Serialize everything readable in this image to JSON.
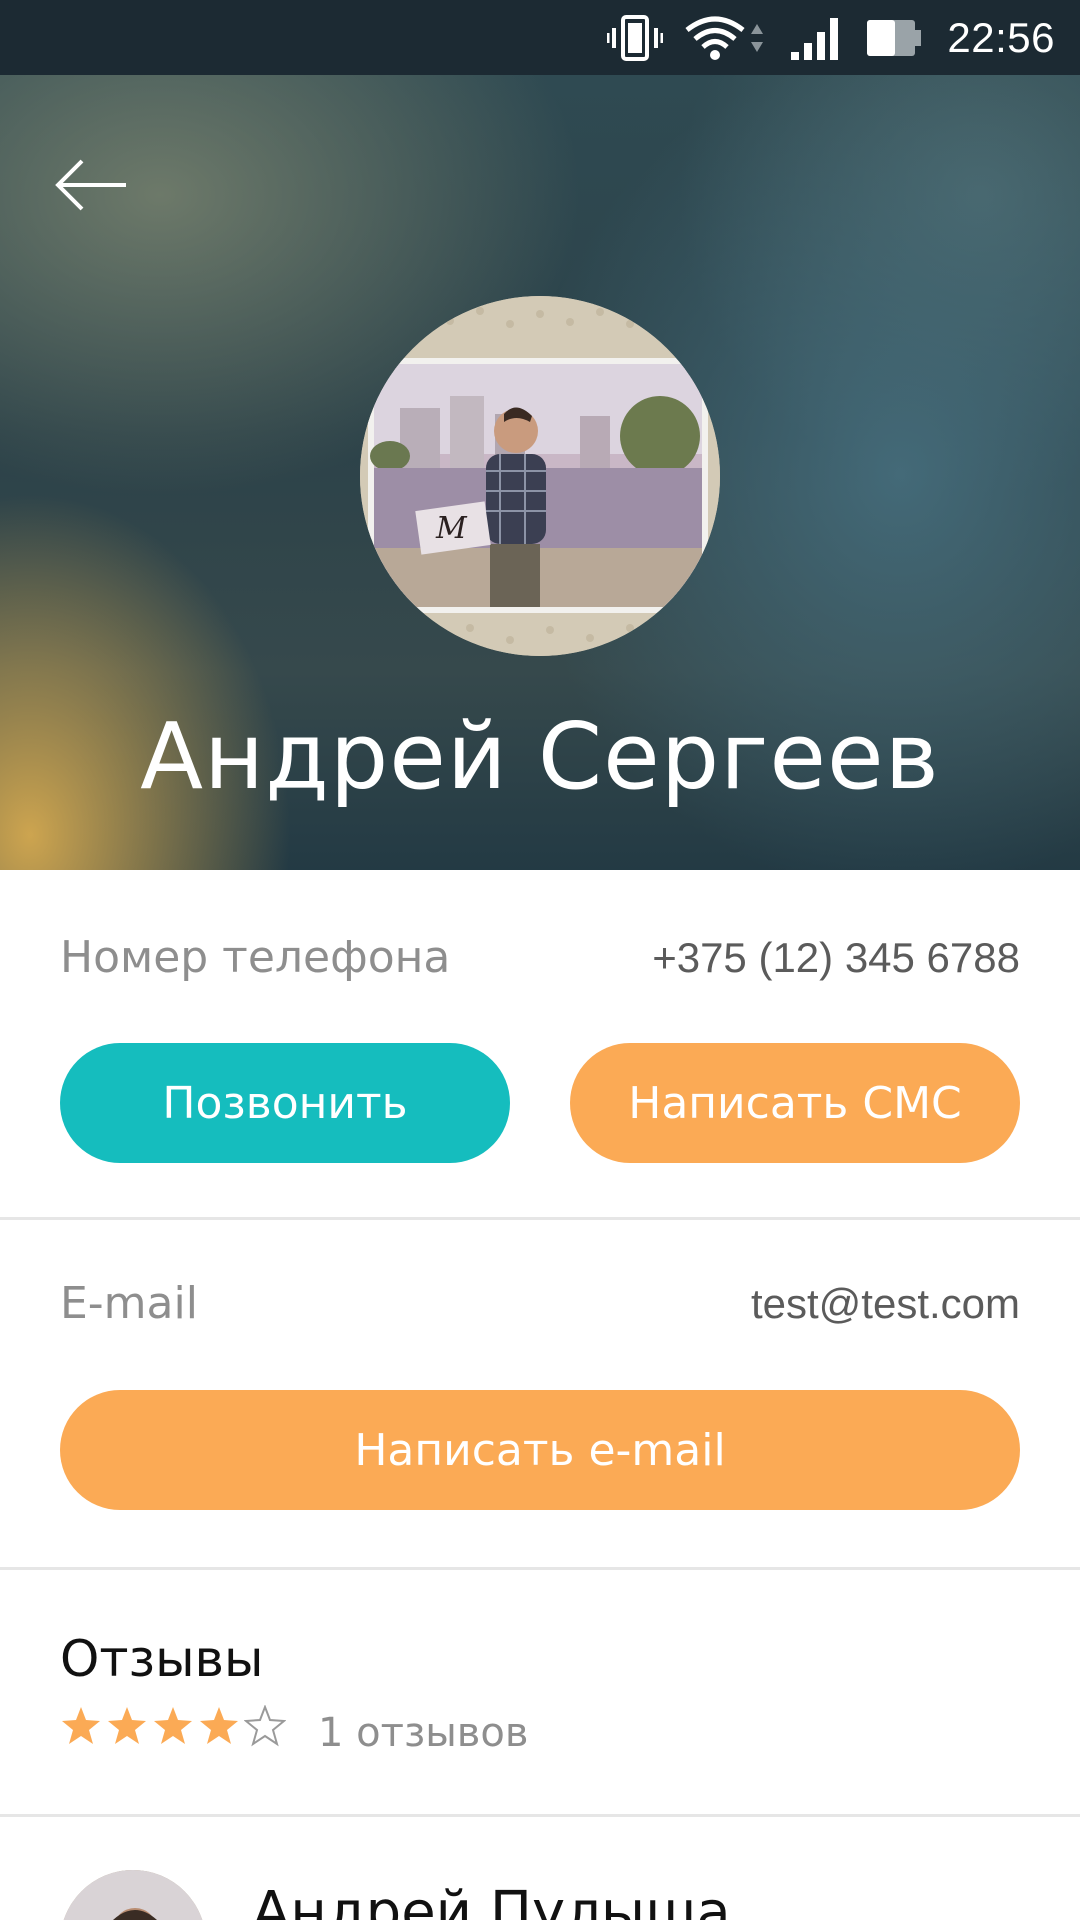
{
  "status_bar": {
    "time": "22:56",
    "icons": [
      "vibrate-icon",
      "wifi-icon",
      "signal-icon",
      "battery-icon"
    ]
  },
  "header": {
    "back_icon": "arrow-left-icon",
    "name": "Андрей Сергеев"
  },
  "phone": {
    "label": "Номер телефона",
    "value": "+375 (12) 345 6788",
    "call_label": "Позвонить",
    "sms_label": "Написать СМС"
  },
  "email": {
    "label": "E-mail",
    "value": "test@test.com",
    "write_label": "Написать e-mail"
  },
  "reviews": {
    "title": "Отзывы",
    "rating": 4,
    "max_rating": 5,
    "count_text": "1 отзывов"
  },
  "review_item": {
    "author": "Андрей Пулыша"
  },
  "colors": {
    "accent_teal": "#15bdbe",
    "accent_orange": "#fbaa55",
    "star_color": "#fbaa55"
  }
}
